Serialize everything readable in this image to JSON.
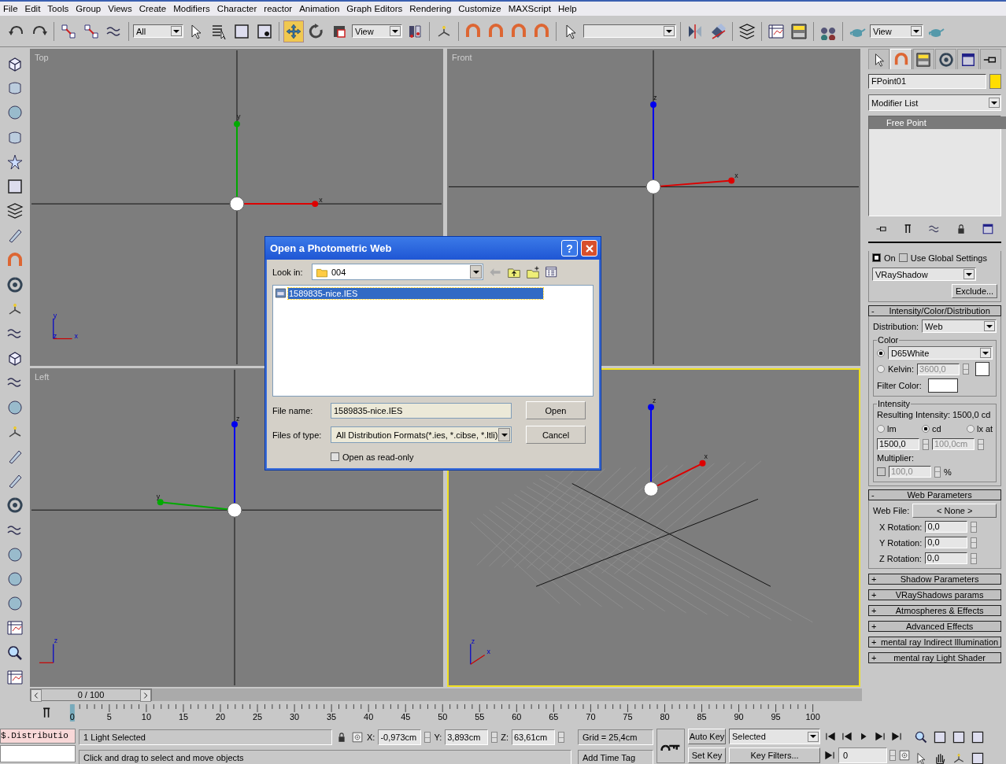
{
  "menu": [
    "File",
    "Edit",
    "Tools",
    "Group",
    "Views",
    "Create",
    "Modifiers",
    "Character",
    "reactor",
    "Animation",
    "Graph Editors",
    "Rendering",
    "Customize",
    "MAXScript",
    "Help"
  ],
  "toolbar": {
    "selection_filter": "All",
    "reference_coord": "View",
    "render_view": "View"
  },
  "viewports": [
    {
      "label": "Top",
      "kind": "top",
      "active": false,
      "gizmo_labels": [
        "y",
        "x"
      ],
      "corner_labels": [
        "y",
        "z",
        "x"
      ]
    },
    {
      "label": "Front",
      "kind": "front",
      "active": false,
      "gizmo_labels": [
        "z",
        "x"
      ]
    },
    {
      "label": "Left",
      "kind": "left",
      "active": false,
      "gizmo_labels": [
        "z",
        "y"
      ],
      "corner_labels": [
        "z"
      ]
    },
    {
      "kind": "persp",
      "active": true,
      "gizmo_labels": [
        "z",
        "x"
      ],
      "corner_labels": [
        "z",
        "x"
      ]
    }
  ],
  "command_panel": {
    "tabs": [
      {
        "kind": "create",
        "selected": false
      },
      {
        "kind": "modify",
        "selected": true
      },
      {
        "kind": "hierarchy",
        "selected": false
      },
      {
        "kind": "motion",
        "selected": false
      },
      {
        "kind": "display",
        "selected": false
      },
      {
        "kind": "utilities",
        "selected": false
      }
    ],
    "object_name": "FPoint01",
    "modifier_list": "Modifier List",
    "stack": [
      {
        "label": "Free Point",
        "selected": true
      }
    ],
    "shadows": {
      "on": {
        "label": "On",
        "checked": true
      },
      "global": {
        "label": "Use Global Settings",
        "checked": false
      },
      "type": "VRayShadow",
      "exclude": "Exclude..."
    },
    "intensity_rollout": {
      "sign": "-",
      "title": "Intensity/Color/Distribution",
      "distribution_label": "Distribution:",
      "distribution": "Web",
      "color_group": "Color",
      "preset": {
        "selected": true,
        "value": "D65White"
      },
      "kelvin": {
        "selected": false,
        "label": "Kelvin:",
        "value": "3600,0"
      },
      "filter_label": "Filter Color:",
      "intensity_group": "Intensity",
      "resulting": "Resulting Intensity:  1500,0 cd",
      "units": [
        {
          "label": "lm",
          "selected": false
        },
        {
          "label": "cd",
          "selected": true
        },
        {
          "label": "lx at",
          "selected": false
        }
      ],
      "value": "1500,0",
      "distance": "100,0cm",
      "multiplier_label": "Multiplier:",
      "multiplier": {
        "checked": false,
        "value": "100,0",
        "unit": "%"
      }
    },
    "web_rollout": {
      "sign": "-",
      "title": "Web Parameters",
      "file_label": "Web File:",
      "file": "< None >",
      "rotations": [
        {
          "label": "X Rotation:",
          "value": "0,0"
        },
        {
          "label": "Y Rotation:",
          "value": "0,0"
        },
        {
          "label": "Z Rotation:",
          "value": "0,0"
        }
      ]
    },
    "collapsed_rollouts": [
      {
        "sign": "+",
        "title": "Shadow Parameters"
      },
      {
        "sign": "+",
        "title": "VRayShadows params"
      },
      {
        "sign": "+",
        "title": "Atmospheres & Effects"
      },
      {
        "sign": "+",
        "title": "Advanced Effects"
      },
      {
        "sign": "+",
        "title": "mental ray Indirect Illumination"
      },
      {
        "sign": "+",
        "title": "mental ray Light Shader"
      }
    ]
  },
  "timeline": {
    "position": "0 / 100",
    "level": 0,
    "ticks": [
      "0",
      "5",
      "10",
      "15",
      "20",
      "25",
      "30",
      "35",
      "40",
      "45",
      "50",
      "55",
      "60",
      "65",
      "70",
      "75",
      "80",
      "85",
      "90",
      "95",
      "100"
    ]
  },
  "listener": {
    "text": "$.Distributio"
  },
  "status": {
    "selection": "1 Light Selected",
    "prompt": "Click and drag to select and move objects",
    "x_label": "X:",
    "x": "-0,973cm",
    "y_label": "Y:",
    "y": "3,893cm",
    "z_label": "Z:",
    "z": "63,61cm",
    "grid": "Grid = 25,4cm",
    "time_tag": "Add Time Tag",
    "auto_key": "Auto Key",
    "set_key": "Set Key",
    "key_mode": "Selected",
    "key_filters": "Key Filters...",
    "frame": "0"
  },
  "dialog": {
    "title": "Open a Photometric Web",
    "help": "?",
    "look_in_label": "Look in:",
    "look_in": "004",
    "files": [
      {
        "name": "1589835-nice.IES",
        "selected": true
      }
    ],
    "file_name_label": "File name:",
    "file_name": "1589835-nice.IES",
    "type_label": "Files of type:",
    "type": "All Distribution Formats(*.ies, *.cibse, *.ltli)",
    "open": "Open",
    "cancel": "Cancel",
    "read_only": {
      "label": "Open as read-only",
      "checked": false
    }
  }
}
